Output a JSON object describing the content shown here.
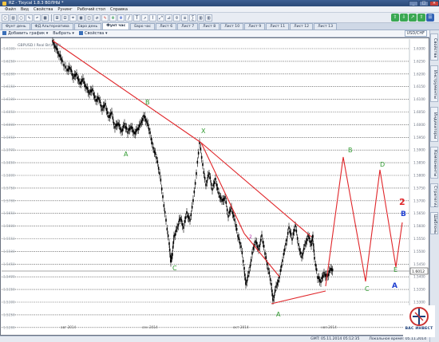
{
  "window": {
    "title": "RZ - Tixycal 1.8.3 BOЛНЫ *",
    "btn_min": "_",
    "btn_max": "□",
    "btn_close": "×"
  },
  "menu": [
    "Файл",
    "Вид",
    "Свойства",
    "Рунинг",
    "Рабочий стол",
    "Справка"
  ],
  "toolbar": {
    "buttons": [
      "▢",
      "▤",
      "▢",
      "✎",
      "↶",
      "▦",
      "|",
      "⊞",
      "⊟",
      "⌖",
      "▣",
      "◫",
      "⇄",
      "✎",
      "⊕",
      "⊕",
      "/",
      "T",
      "↗",
      "⌇",
      "⤢",
      "⊿",
      "⊙",
      "≡",
      "∑",
      "▥",
      "▥"
    ],
    "right_icons": [
      "⇧",
      "⇩",
      "↗",
      "⇧",
      "☰"
    ]
  },
  "tabs": [
    "Фунт день",
    "ФД Альтернатива",
    "Евро день",
    "Фунт час",
    "Евро час",
    "Лист 6",
    "Лист 7",
    "Лист 8",
    "Лист 10",
    "Лист 9",
    "Лист 11",
    "Лист 12",
    "Лист 13"
  ],
  "active_tab": 3,
  "chart_tools": {
    "add_chart": "Добавить график ▾",
    "select": "Выбрать ▾",
    "properties": "Свойства ▾",
    "symbol": "USD/CHF"
  },
  "side_panels": [
    "Свойства",
    "Инструменты",
    "Индикаторы",
    "Компоненты",
    "Стратегии",
    "Шаблоны"
  ],
  "chart_header": "GBPUSD.I Real Br(m30)",
  "price_ticks": [
    "1.6300",
    "1.6250",
    "1.6200",
    "1.6150",
    "1.6100",
    "1.6050",
    "1.6000",
    "1.5950",
    "1.5900",
    "1.5850",
    "1.5800",
    "1.5750",
    "1.5700",
    "1.5650",
    "1.5600",
    "1.5550",
    "1.5500",
    "1.5450",
    "1.5400",
    "1.5350",
    "1.5300",
    "1.5250",
    "1.5200"
  ],
  "current_price": "1.6012",
  "time_labels": [
    "авг 2014",
    "сен 2014",
    "окт 2014",
    "ноя 2014"
  ],
  "wave_labels": {
    "green": [
      "B",
      "A",
      "X",
      "C",
      "A",
      "B",
      "C",
      "D",
      "E"
    ],
    "magenta": [
      "2"
    ],
    "red": "2",
    "blue": "B",
    "blue_bottom": "A"
  },
  "status": {
    "gmt": "GMT: 05.11.2014 05:12:35",
    "local": "Локальное время: 05.11.2014"
  },
  "logo": {
    "name": "ВАС ИНВЕСТ"
  },
  "colors": {
    "trendline": "#e0262a",
    "wave_label": "#2f9a2f",
    "candles": "#000000",
    "grid_dotted": "#3c3c3c",
    "current_price_line": "#8a8a8a",
    "accent": "#2b4a78"
  }
}
